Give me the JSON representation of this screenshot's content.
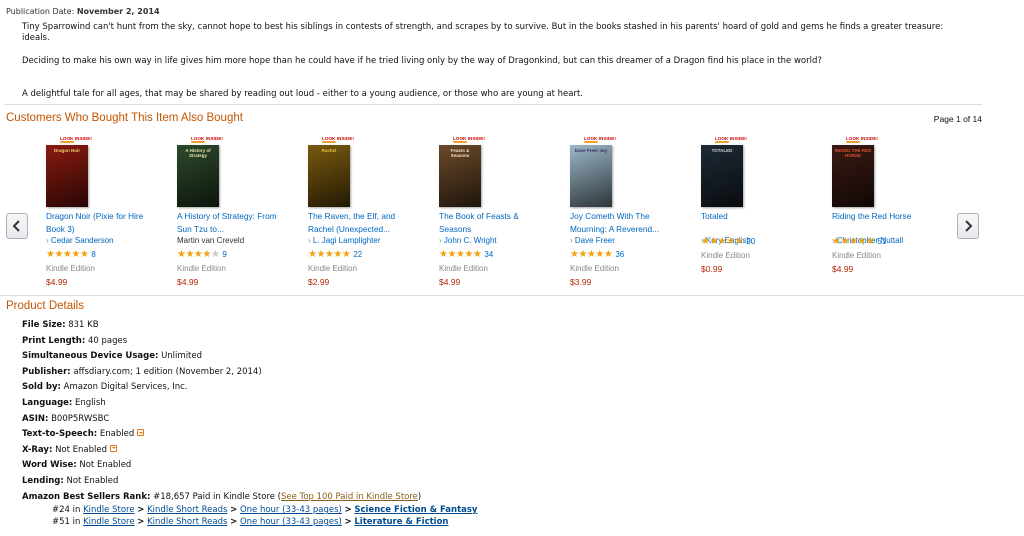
{
  "publication": {
    "label": "Publication Date:",
    "value": "November 2, 2014"
  },
  "description": {
    "p1": "Tiny Sparrowind can't hunt from the sky, cannot hope to best his siblings in contests of strength, and scrapes by to survive. But in the books stashed in his parents' hoard of gold and gems he finds a greater treasure: ideals.",
    "p2": "Deciding to make his own way in life gives him more hope than he could have if he tried living only by the way of Dragonkind, but can this dreamer of a Dragon find his place in the world?",
    "p3": "A delightful tale for all ages, that may be shared by reading out loud - either to a young audience, or those who are young at heart."
  },
  "also_bought": {
    "title": "Customers Who Bought This Item Also Bought",
    "pager": "Page 1 of 14",
    "look_inside": "LOOK INSIDE!",
    "items": [
      {
        "title": "Dragon Noir (Pixie for Hire Book 3)",
        "author": "Cedar Sanderson",
        "author_link": true,
        "stars": 5,
        "count": "8",
        "format": "Kindle Edition",
        "price": "$4.99",
        "cover_text": "Dragon Noir",
        "cover_bg": "#8b1a10",
        "cover_fg": "#f3d36a"
      },
      {
        "title": "A History of Strategy: From Sun Tzu to...",
        "author": "Martin van Creveld",
        "author_link": false,
        "stars": 4,
        "count": "9",
        "format": "Kindle Edition",
        "price": "$4.99",
        "cover_text": "A History of Strategy",
        "cover_bg": "#2d4a2b",
        "cover_fg": "#e8e0b0"
      },
      {
        "title": "The Raven, the Elf, and Rachel (Unexpected...",
        "author": "L. Jagi Lamplighter",
        "author_link": true,
        "stars": 4.5,
        "count": "22",
        "format": "Kindle Edition",
        "price": "$2.99",
        "cover_text": "Rachel",
        "cover_bg": "#7a5a10",
        "cover_fg": "#f0c040"
      },
      {
        "title": "The Book of Feasts & Seasons",
        "author": "John C. Wright",
        "author_link": true,
        "stars": 4.5,
        "count": "34",
        "format": "Kindle Edition",
        "price": "$4.99",
        "cover_text": "Feasts & Seasons",
        "cover_bg": "#6b4a2a",
        "cover_fg": "#f5e0c0"
      },
      {
        "title": "Joy Cometh With The Mourning: A Reverend...",
        "author": "Dave Freer",
        "author_link": true,
        "stars": 4.5,
        "count": "36",
        "format": "Kindle Edition",
        "price": "$3.99",
        "cover_text": "Dave Freer Joy",
        "cover_bg": "#9cb8c8",
        "cover_fg": "#3a2a60"
      },
      {
        "title": "Totaled",
        "author": "Kary English",
        "author_link": true,
        "stars": 5,
        "count": "20",
        "format": "Kindle Edition",
        "price": "$0.99",
        "cover_text": "TOTALED",
        "cover_bg": "#1e2a35",
        "cover_fg": "#d0d8e0"
      },
      {
        "title": "Riding the Red Horse",
        "author": "Christopher Nuttall",
        "author_link": true,
        "stars": 4.5,
        "count": "51",
        "format": "Kindle Edition",
        "price": "$4.99",
        "cover_text": "RIDING THE RED HORSE",
        "cover_bg": "#3a1a14",
        "cover_fg": "#e05030"
      }
    ]
  },
  "product_details": {
    "title": "Product Details",
    "file_size": {
      "label": "File Size:",
      "value": "831 KB"
    },
    "print_length": {
      "label": "Print Length:",
      "value": "40 pages"
    },
    "simultaneous": {
      "label": "Simultaneous Device Usage:",
      "value": "Unlimited"
    },
    "publisher": {
      "label": "Publisher:",
      "value": "affsdiary.com; 1 edition (November 2, 2014)"
    },
    "sold_by": {
      "label": "Sold by:",
      "value": "Amazon Digital Services, Inc."
    },
    "language": {
      "label": "Language:",
      "value": "English"
    },
    "asin": {
      "label": "ASIN:",
      "value": "B00P5RWSBC"
    },
    "tts": {
      "label": "Text-to-Speech:",
      "value": "Enabled"
    },
    "xray": {
      "label": "X-Ray:",
      "value": "Not Enabled"
    },
    "word_wise": {
      "label": "Word Wise:",
      "value": "Not Enabled"
    },
    "lending": {
      "label": "Lending:",
      "value": "Not Enabled"
    },
    "rank": {
      "label": "Amazon Best Sellers Rank:",
      "value": "#18,657 Paid in Kindle Store (",
      "link": "See Top 100 Paid in Kindle Store",
      "close": ")",
      "sub": [
        {
          "num": "#24 in",
          "c1": "Kindle Store",
          "c2": "Kindle Short Reads",
          "c3": "One hour (33-43 pages)",
          "c4": "Science Fiction & Fantasy"
        },
        {
          "num": "#51 in",
          "c1": "Kindle Store",
          "c2": "Kindle Short Reads",
          "c3": "One hour (33-43 pages)",
          "c4": "Literature & Fiction"
        }
      ],
      "sep": ">"
    }
  }
}
